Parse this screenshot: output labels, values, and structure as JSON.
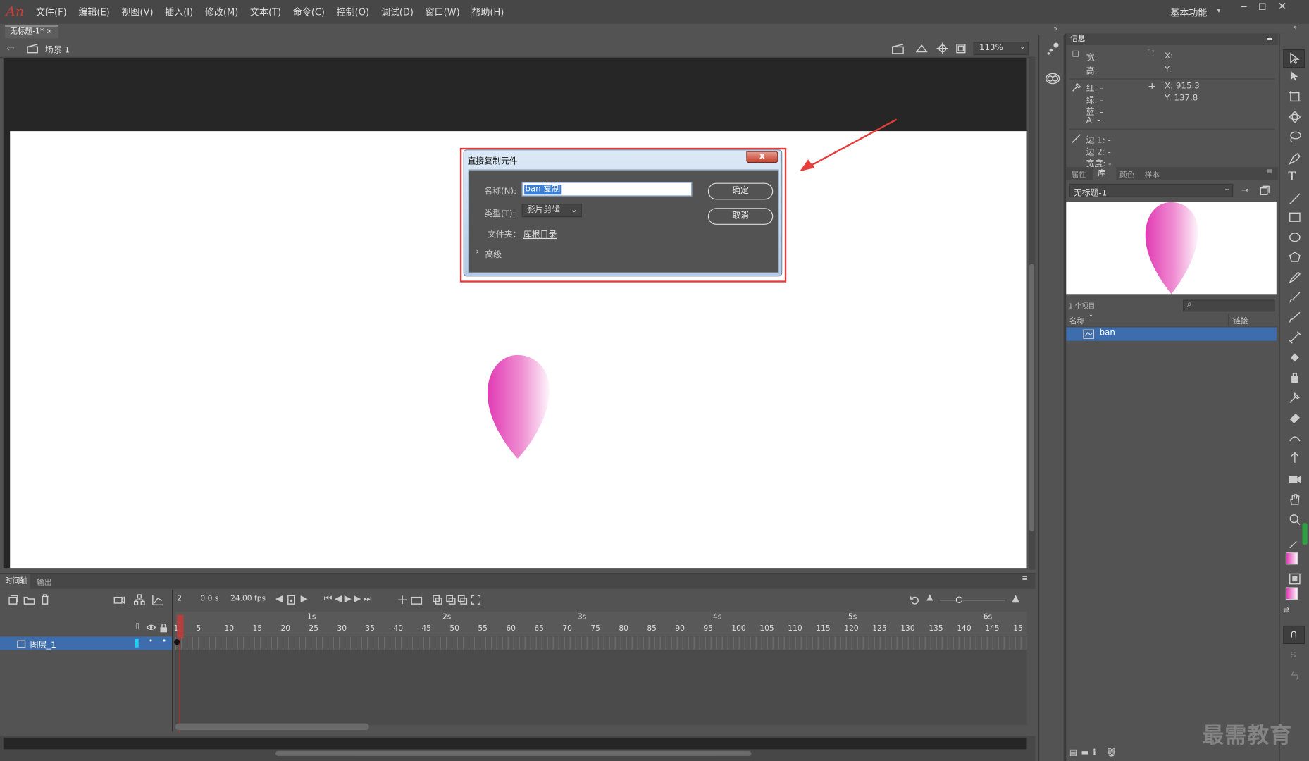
{
  "app": {
    "logo": "An"
  },
  "menu": [
    "文件(F)",
    "编辑(E)",
    "视图(V)",
    "插入(I)",
    "修改(M)",
    "文本(T)",
    "命令(C)",
    "控制(O)",
    "调试(D)",
    "窗口(W)",
    "帮助(H)"
  ],
  "workspace": "基本功能",
  "document": {
    "tab": "无标题-1*",
    "scene": "场景 1",
    "zoom": "113%"
  },
  "dialog": {
    "title": "直接复制元件",
    "name_label": "名称(N):",
    "name_value": "ban 复制",
    "type_label": "类型(T):",
    "type_value": "影片剪辑",
    "folder_label": "文件夹：",
    "folder_value": "库根目录",
    "advanced": "高级",
    "ok": "确定",
    "cancel": "取消",
    "close": "x"
  },
  "timeline": {
    "tabs": [
      "时间轴",
      "输出"
    ],
    "frame": "2",
    "time": "0.0 s",
    "fps": "24.00 fps",
    "layer": "图层_1",
    "seconds": [
      "1s",
      "2s",
      "3s",
      "4s",
      "5s",
      "6s"
    ],
    "frames": [
      "1",
      "5",
      "10",
      "15",
      "20",
      "25",
      "30",
      "35",
      "40",
      "45",
      "50",
      "55",
      "60",
      "65",
      "70",
      "75",
      "80",
      "85",
      "90",
      "95",
      "100",
      "105",
      "110",
      "115",
      "120",
      "125",
      "130",
      "135",
      "140",
      "145",
      "15"
    ]
  },
  "info": {
    "title": "信息",
    "width_label": "宽:",
    "height_label": "高:",
    "x_label": "X:",
    "y_label": "Y:",
    "red": "红: -",
    "green": "绿: -",
    "blue": "蓝: -",
    "alpha": "A: -",
    "mouse_x": "X:  915.3",
    "mouse_y": "Y:  137.8",
    "edge1": "边 1: -",
    "edge2": "边 2: -",
    "stroke_width": "宽度: -"
  },
  "library": {
    "tabs": [
      "属性",
      "库",
      "颜色",
      "样本"
    ],
    "doc": "无标题-1",
    "count": "1 个项目",
    "col_name": "名称",
    "col_link": "链接",
    "item": "ban"
  },
  "watermark": "最需教育",
  "colors": {
    "accent": "#3d6dad",
    "highlight": "#e53c3c",
    "petal": "#e13bb4"
  }
}
